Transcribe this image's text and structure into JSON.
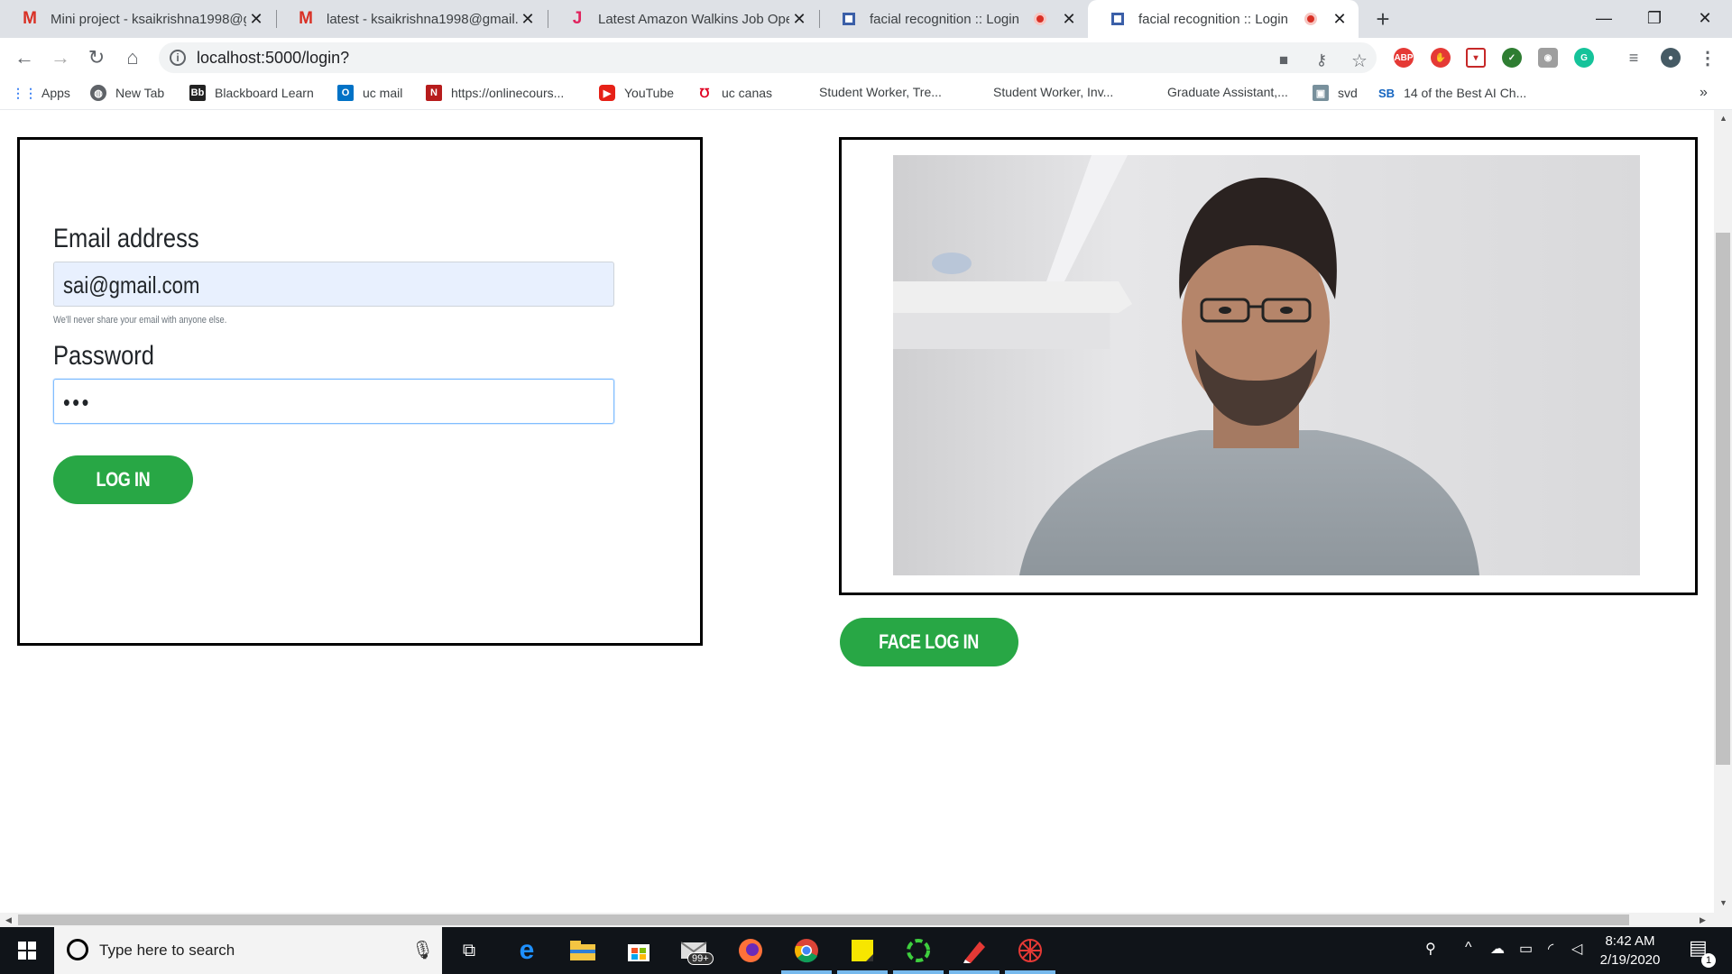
{
  "browser": {
    "tabs": [
      {
        "title": "Mini project - ksaikrishna1998@g",
        "favicon": "gmail-icon"
      },
      {
        "title": "latest - ksaikrishna1998@gmail.c",
        "favicon": "gmail-icon"
      },
      {
        "title": "Latest Amazon Walkins Job Oper",
        "favicon": "j-icon"
      },
      {
        "title": "facial recognition :: Login",
        "favicon": "page-icon"
      },
      {
        "title": "facial recognition :: Login",
        "favicon": "page-icon"
      }
    ],
    "url": "localhost:5000/login?",
    "bookmarks": [
      {
        "label": "Apps"
      },
      {
        "label": "New Tab"
      },
      {
        "label": "Blackboard Learn"
      },
      {
        "label": "uc mail"
      },
      {
        "label": "https://onlinecours..."
      },
      {
        "label": "YouTube"
      },
      {
        "label": "uc canas"
      },
      {
        "label": "Student Worker, Tre..."
      },
      {
        "label": "Student Worker, Inv..."
      },
      {
        "label": "Graduate Assistant,..."
      },
      {
        "label": "svd"
      },
      {
        "label": "14 of the Best AI Ch..."
      }
    ],
    "more_bookmarks": "»"
  },
  "login_form": {
    "email_label": "Email address",
    "email_value": "sai@gmail.com",
    "email_help": "We'll never share your email with anyone else.",
    "password_label": "Password",
    "password_value": "•••",
    "login_button": "LOG IN"
  },
  "face_login": {
    "button": "FACE LOG IN"
  },
  "taskbar": {
    "search_placeholder": "Type here to search",
    "badge": "99+",
    "time": "8:42 AM",
    "date": "2/19/2020",
    "notification_count": "1"
  },
  "colors": {
    "accent_green": "#28a745",
    "autofill_blue": "#e8f0fe",
    "focus_border": "#80bdff"
  }
}
